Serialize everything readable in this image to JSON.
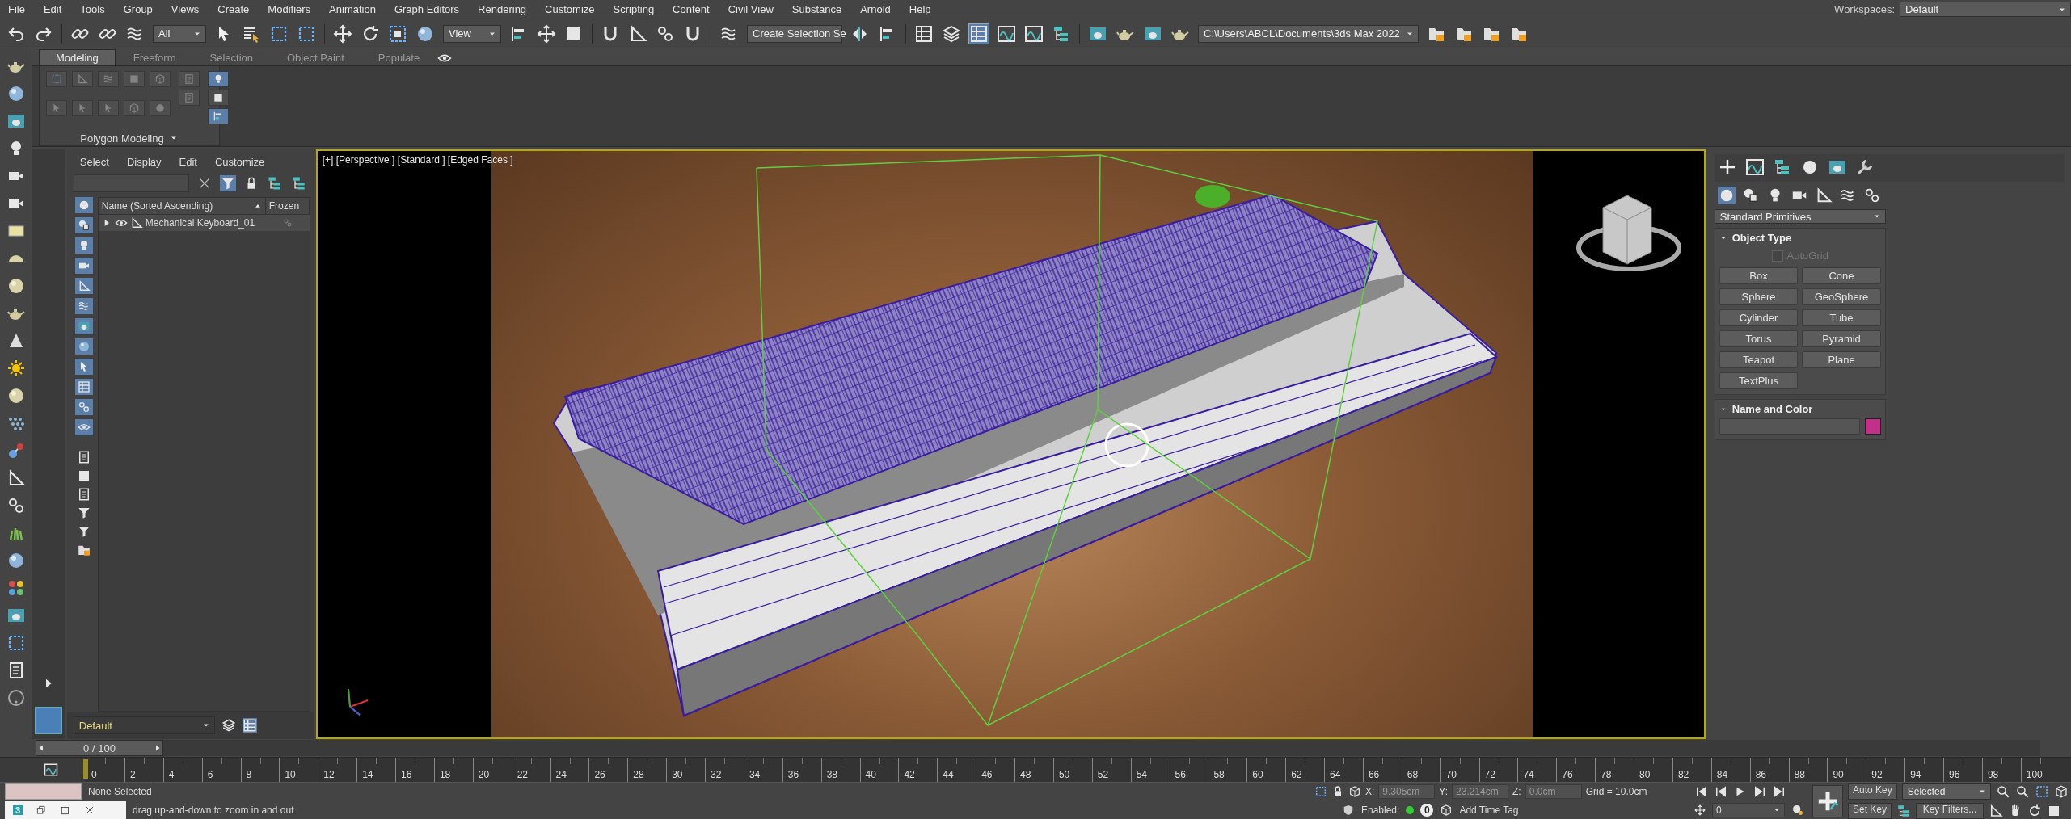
{
  "menu_bar": {
    "items": [
      "File",
      "Edit",
      "Tools",
      "Group",
      "Views",
      "Create",
      "Modifiers",
      "Animation",
      "Graph Editors",
      "Rendering",
      "Customize",
      "Scripting",
      "Content",
      "Civil View",
      "Substance",
      "Arnold",
      "Help"
    ],
    "workspaces_label": "Workspaces:",
    "workspace": "Default"
  },
  "main_toolbar": {
    "selection_filter": "All",
    "reference_coordinate": "View",
    "named_selection": "Create Selection Se",
    "project_path": "C:\\Users\\ABCL\\Documents\\3ds Max 2022"
  },
  "ribbon": {
    "tabs": [
      {
        "label": "Modeling",
        "selected": true
      },
      {
        "label": "Freeform",
        "selected": false
      },
      {
        "label": "Selection",
        "selected": false
      },
      {
        "label": "Object Paint",
        "selected": false
      },
      {
        "label": "Populate",
        "selected": false
      }
    ],
    "panel_label": "Polygon Modeling"
  },
  "scene_explorer": {
    "menu": [
      "Select",
      "Display",
      "Edit",
      "Customize"
    ],
    "columns": [
      "Name (Sorted Ascending)",
      "Frozen"
    ],
    "rows": [
      {
        "name": "Mechanical Keyboard_01",
        "expanded": false
      }
    ],
    "layer": "Default"
  },
  "viewport": {
    "label": "[+] [Perspective ] [Standard ] [Edged Faces ]"
  },
  "command_panel": {
    "category": "Standard Primitives",
    "object_type": {
      "title": "Object Type",
      "autogrid": {
        "label": "AutoGrid",
        "checked": false,
        "disabled": true
      },
      "buttons": [
        "Box",
        "Cone",
        "Sphere",
        "GeoSphere",
        "Cylinder",
        "Tube",
        "Torus",
        "Pyramid",
        "Teapot",
        "Plane",
        "TextPlus"
      ]
    },
    "name_and_color": {
      "title": "Name and Color",
      "color": "#c2308a"
    }
  },
  "time_slider": {
    "label": "0 / 100",
    "level": 0
  },
  "track_bar": {
    "ticks": [
      "0",
      "2",
      "4",
      "6",
      "8",
      "10",
      "12",
      "14",
      "16",
      "18",
      "20",
      "22",
      "24",
      "26",
      "28",
      "30",
      "32",
      "34",
      "36",
      "38",
      "40",
      "42",
      "44",
      "46",
      "48",
      "50",
      "52",
      "54",
      "56",
      "58",
      "60",
      "62",
      "64",
      "66",
      "68",
      "70",
      "72",
      "74",
      "76",
      "78",
      "80",
      "82",
      "84",
      "86",
      "88",
      "90",
      "92",
      "94",
      "96",
      "98",
      "100"
    ]
  },
  "status_bar": {
    "selection": "None Selected",
    "listener_badge": "3",
    "prompt": "drag up-and-down to zoom in and out",
    "x_label": "X:",
    "x": "9.305cm",
    "y_label": "Y:",
    "y": "23.214cm",
    "z_label": "Z:",
    "z": "0.0cm",
    "grid": "Grid = 10.0cm",
    "enabled_label": "Enabled:",
    "time_tag_count": "0",
    "add_time_tag": "Add Time Tag",
    "frame": "0",
    "auto_key": "Auto Key",
    "set_key": "Set Key",
    "key_mode": "Selected",
    "key_filters": "Key Filters..."
  }
}
